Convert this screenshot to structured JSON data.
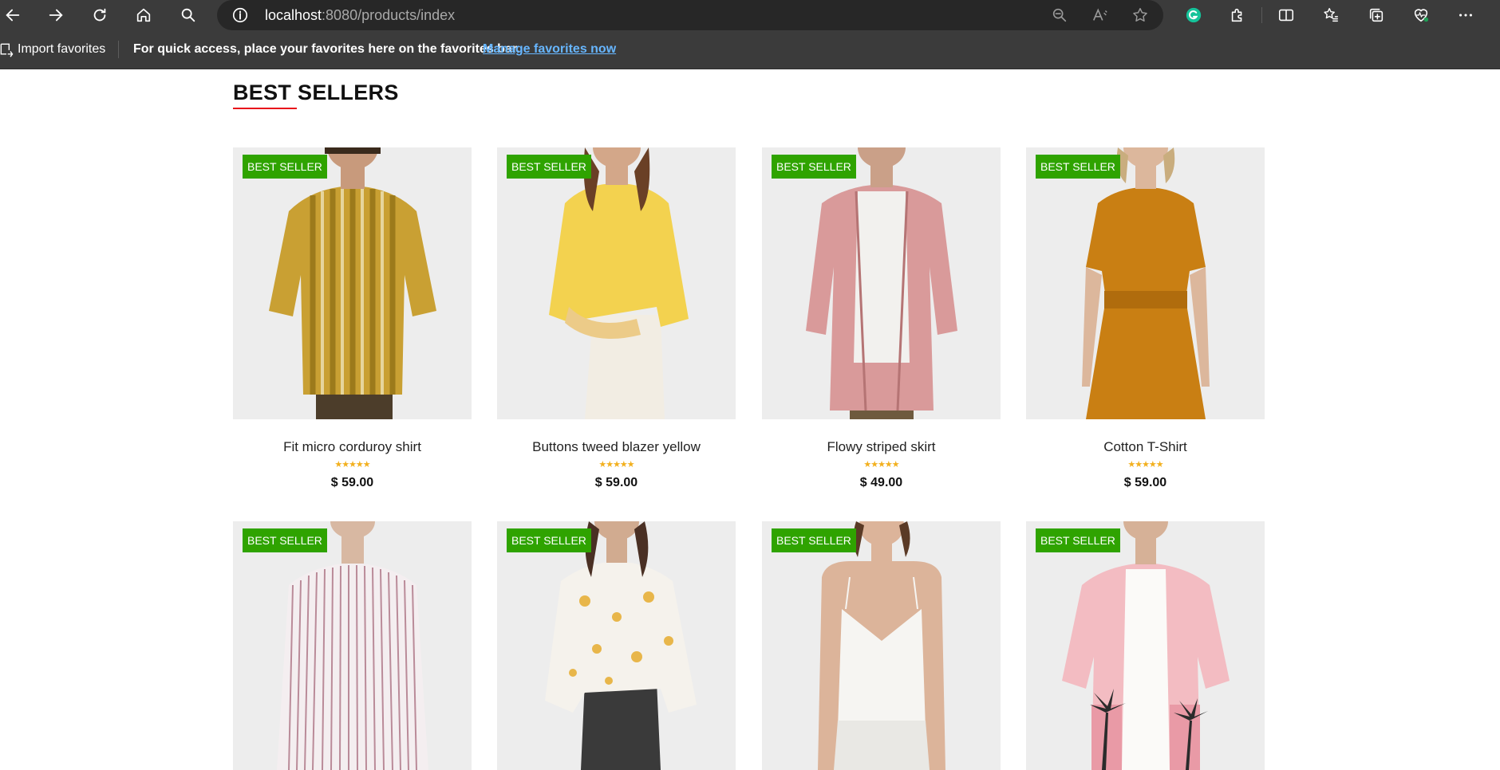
{
  "browser": {
    "url_host": "localhost",
    "url_rest": ":8080/products/index"
  },
  "favorites_bar": {
    "import_label": "Import favorites",
    "message": "For quick access, place your favorites here on the favorites bar.",
    "manage_link": "Manage favorites now"
  },
  "section": {
    "title": "BEST SELLERS"
  },
  "products": [
    {
      "badge": "BEST SELLER",
      "name": "Fit micro corduroy shirt",
      "rating": "★★★★★",
      "price": "$ 59.00"
    },
    {
      "badge": "BEST SELLER",
      "name": "Buttons tweed blazer yellow",
      "rating": "★★★★★",
      "price": "$ 59.00"
    },
    {
      "badge": "BEST SELLER",
      "name": "Flowy striped skirt",
      "rating": "★★★★★",
      "price": "$ 49.00"
    },
    {
      "badge": "BEST SELLER",
      "name": "Cotton T-Shirt",
      "rating": "★★★★★",
      "price": "$ 59.00"
    },
    {
      "badge": "BEST SELLER"
    },
    {
      "badge": "BEST SELLER"
    },
    {
      "badge": "BEST SELLER"
    },
    {
      "badge": "BEST SELLER"
    }
  ]
}
